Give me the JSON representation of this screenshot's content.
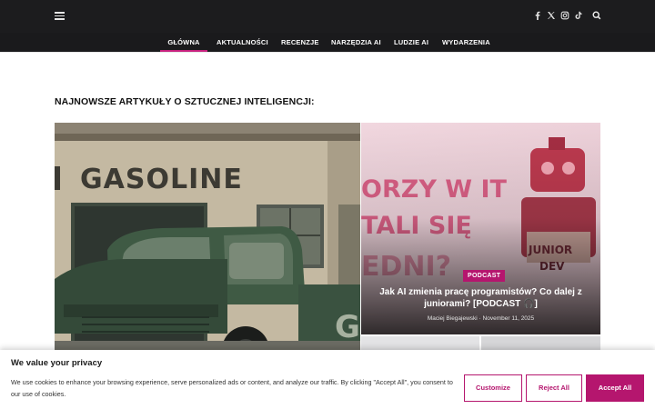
{
  "header": {
    "menu_icon": "hamburger-icon",
    "social_icons": [
      "facebook-icon",
      "x-icon",
      "instagram-icon",
      "tiktok-icon"
    ],
    "search_icon": "search-icon"
  },
  "nav": {
    "items": [
      {
        "label": "GŁÓWNA",
        "active": true
      },
      {
        "label": "AKTUALNOŚCI"
      },
      {
        "label": "RECENZJE"
      },
      {
        "label": "NARZĘDZIA AI"
      },
      {
        "label": "LUDZIE AI"
      },
      {
        "label": "WYDARZENIA"
      }
    ]
  },
  "main": {
    "section_title": "NAJNOWSZE ARTYKUŁY O SZTUCZNEJ INTELIGENCJI:",
    "hero_left": {
      "image_text": "GASOLINE"
    },
    "hero_right": {
      "badge": "PODCAST",
      "title": "Jak AI zmienia pracę programistów? Co dalej z juniorami? [PODCAST 🎧]",
      "author": "Maciej Biegajewski",
      "date": "November 11, 2025"
    }
  },
  "cookie_banner": {
    "title": "We value your privacy",
    "text": "We use cookies to enhance your browsing experience, serve personalized ads or content, and analyze our traffic. By clicking \"Accept All\", you consent to our use of cookies.",
    "customize_label": "Customize",
    "reject_label": "Reject All",
    "accept_label": "Accept All"
  },
  "colors": {
    "accent": "#b5166e",
    "header_bg": "#1c1c1e"
  }
}
